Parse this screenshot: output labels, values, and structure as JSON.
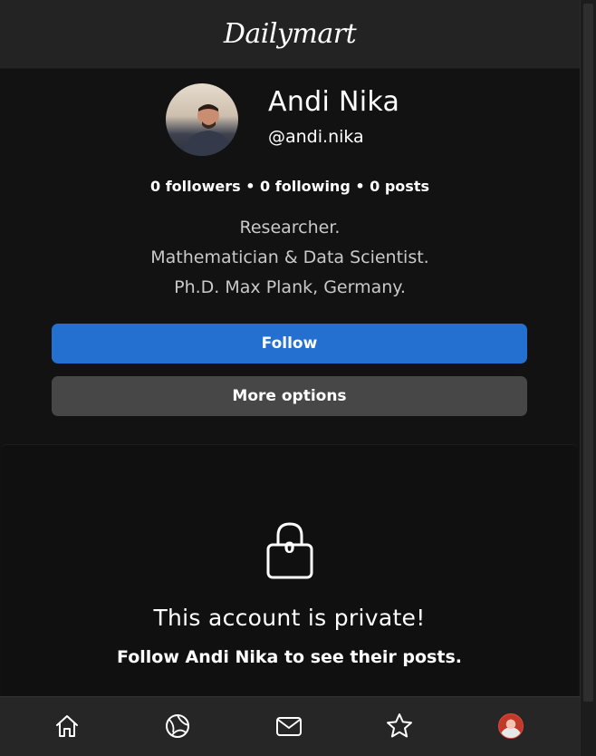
{
  "app": {
    "brand": "Dailymart"
  },
  "profile": {
    "name": "Andi Nika",
    "handle": "@andi.nika",
    "stats": "0 followers • 0 following • 0 posts",
    "bio": [
      "Researcher.",
      "Mathematician & Data Scientist.",
      "Ph.D. Max Plank, Germany."
    ]
  },
  "actions": {
    "follow_label": "Follow",
    "more_label": "More options"
  },
  "private": {
    "lock_count": "0",
    "title": "This account is private!",
    "subtitle": "Follow Andi Nika to see their posts."
  },
  "nav": {
    "items": [
      {
        "icon": "home-icon"
      },
      {
        "icon": "globe-icon"
      },
      {
        "icon": "mail-icon"
      },
      {
        "icon": "star-icon"
      },
      {
        "icon": "profile-avatar"
      }
    ]
  },
  "colors": {
    "accent": "#2470d1",
    "secondary_button": "#474747",
    "background": "#121212",
    "bar": "#232323"
  }
}
